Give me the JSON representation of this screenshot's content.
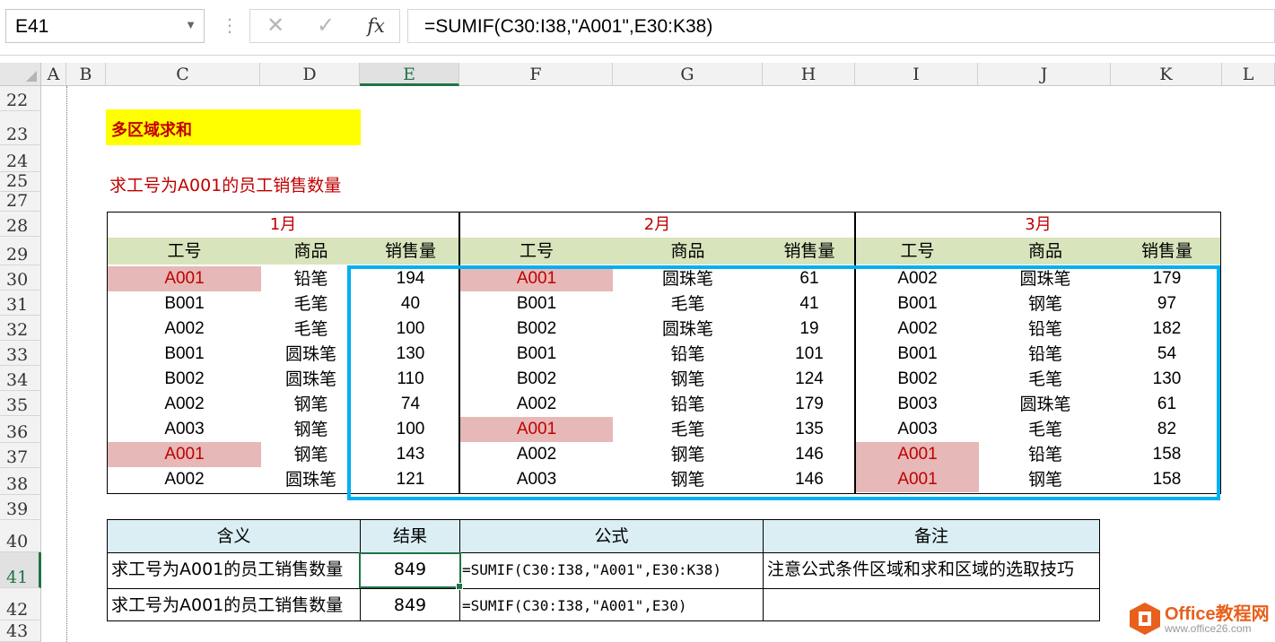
{
  "formula_bar": {
    "name_box": "E41",
    "cancel_icon": "✕",
    "enter_icon": "✓",
    "fx_label": "fx",
    "formula": "=SUMIF(C30:I38,\"A001\",E30:K38)"
  },
  "columns": [
    "A",
    "B",
    "C",
    "D",
    "E",
    "F",
    "G",
    "H",
    "I",
    "J",
    "K",
    "L"
  ],
  "selected_column": "E",
  "rows": [
    "22",
    "23",
    "24",
    "25",
    "27",
    "28",
    "29",
    "30",
    "31",
    "32",
    "33",
    "34",
    "35",
    "36",
    "37",
    "38",
    "39",
    "40",
    "41",
    "42",
    "43"
  ],
  "selected_row": "41",
  "title": "多区域求和",
  "subtitle": "求工号为A001的员工销售数量",
  "tables": [
    {
      "month": "1月",
      "headers": [
        "工号",
        "商品",
        "销售量"
      ],
      "rows": [
        {
          "id": "A001",
          "product": "铅笔",
          "qty": "194",
          "hl": true
        },
        {
          "id": "B001",
          "product": "毛笔",
          "qty": "40",
          "hl": false
        },
        {
          "id": "A002",
          "product": "毛笔",
          "qty": "100",
          "hl": false
        },
        {
          "id": "B001",
          "product": "圆珠笔",
          "qty": "130",
          "hl": false
        },
        {
          "id": "B002",
          "product": "圆珠笔",
          "qty": "110",
          "hl": false
        },
        {
          "id": "A002",
          "product": "钢笔",
          "qty": "74",
          "hl": false
        },
        {
          "id": "A003",
          "product": "钢笔",
          "qty": "100",
          "hl": false
        },
        {
          "id": "A001",
          "product": "钢笔",
          "qty": "143",
          "hl": true
        },
        {
          "id": "A002",
          "product": "圆珠笔",
          "qty": "121",
          "hl": false
        }
      ]
    },
    {
      "month": "2月",
      "headers": [
        "工号",
        "商品",
        "销售量"
      ],
      "rows": [
        {
          "id": "A001",
          "product": "圆珠笔",
          "qty": "61",
          "hl": true
        },
        {
          "id": "B001",
          "product": "毛笔",
          "qty": "41",
          "hl": false
        },
        {
          "id": "B002",
          "product": "圆珠笔",
          "qty": "19",
          "hl": false
        },
        {
          "id": "B001",
          "product": "铅笔",
          "qty": "101",
          "hl": false
        },
        {
          "id": "B002",
          "product": "钢笔",
          "qty": "124",
          "hl": false
        },
        {
          "id": "A002",
          "product": "铅笔",
          "qty": "179",
          "hl": false
        },
        {
          "id": "A001",
          "product": "毛笔",
          "qty": "135",
          "hl": true
        },
        {
          "id": "A002",
          "product": "钢笔",
          "qty": "146",
          "hl": false
        },
        {
          "id": "A003",
          "product": "钢笔",
          "qty": "146",
          "hl": false
        }
      ]
    },
    {
      "month": "3月",
      "headers": [
        "工号",
        "商品",
        "销售量"
      ],
      "rows": [
        {
          "id": "A002",
          "product": "圆珠笔",
          "qty": "179",
          "hl": false
        },
        {
          "id": "B001",
          "product": "钢笔",
          "qty": "97",
          "hl": false
        },
        {
          "id": "A002",
          "product": "铅笔",
          "qty": "182",
          "hl": false
        },
        {
          "id": "B001",
          "product": "铅笔",
          "qty": "54",
          "hl": false
        },
        {
          "id": "B002",
          "product": "毛笔",
          "qty": "130",
          "hl": false
        },
        {
          "id": "B003",
          "product": "圆珠笔",
          "qty": "61",
          "hl": false
        },
        {
          "id": "A003",
          "product": "毛笔",
          "qty": "82",
          "hl": false
        },
        {
          "id": "A001",
          "product": "铅笔",
          "qty": "158",
          "hl": true
        },
        {
          "id": "A001",
          "product": "钢笔",
          "qty": "158",
          "hl": true
        }
      ]
    }
  ],
  "summary": {
    "headers": [
      "含义",
      "结果",
      "公式",
      "备注"
    ],
    "rows": [
      [
        "求工号为A001的员工销售数量",
        "849",
        "=SUMIF(C30:I38,\"A001\",E30:K38)",
        "注意公式条件区域和求和区域的选取技巧"
      ],
      [
        "求工号为A001的员工销售数量",
        "849",
        "=SUMIF(C30:I38,\"A001\",E30)",
        ""
      ]
    ]
  },
  "watermark": {
    "line1": "Office教程网",
    "line2": "www.office26.com"
  }
}
